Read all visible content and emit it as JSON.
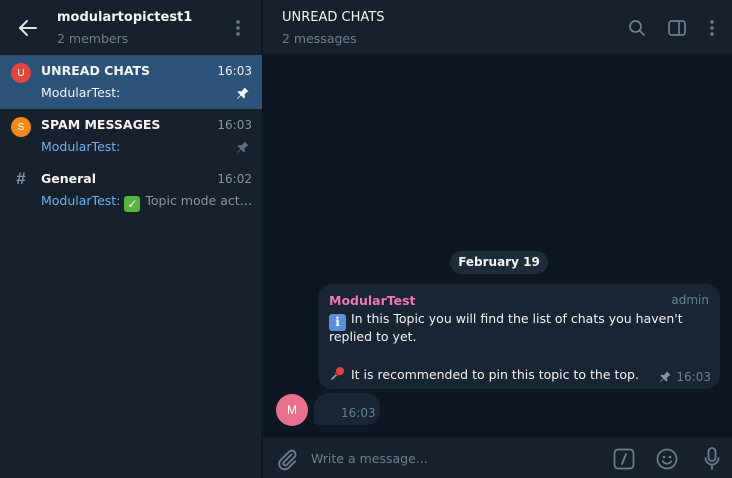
{
  "left_panel": {
    "group_title": "modulartopictest1",
    "group_subtitle": "2 members",
    "topics": [
      {
        "icon_letter": "U",
        "icon_color": "#e0463d",
        "name": "UNREAD CHATS",
        "time": "16:03",
        "sender": "ModularTest:",
        "preview": "",
        "pinned": true,
        "active": true
      },
      {
        "icon_letter": "S",
        "icon_color": "#ef8a1a",
        "name": "SPAM MESSAGES",
        "time": "16:03",
        "sender": "ModularTest:",
        "preview": "",
        "pinned": true,
        "active": false
      },
      {
        "icon_letter": "#",
        "icon_color": "",
        "name": "General",
        "time": "16:02",
        "sender": "ModularTest:",
        "preview": "Topic mode acti…",
        "pinned": false,
        "active": false
      }
    ]
  },
  "chat_header": {
    "title": "UNREAD CHATS",
    "subtitle": "2 messages"
  },
  "messages": {
    "date_divider": "February 19",
    "first": {
      "sender": "ModularTest",
      "role": "admin",
      "line1": "In this Topic you will find the list of chats you haven't",
      "line2": "replied to yet.",
      "line3": "It is recommended to pin this topic to the top.",
      "time": "16:03"
    },
    "second": {
      "avatar_letter": "M",
      "time": "16:03"
    }
  },
  "composer": {
    "placeholder": "Write a message..."
  },
  "colors": {
    "accent": "#2b5278",
    "sender_name": "#ee7aae",
    "link_sender": "#6ab3f3"
  }
}
